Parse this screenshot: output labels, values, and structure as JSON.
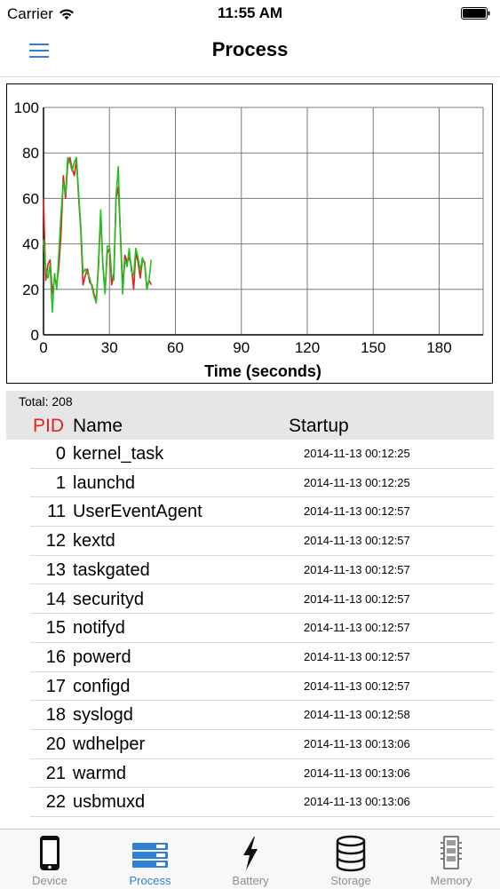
{
  "status_bar": {
    "carrier": "Carrier",
    "time": "11:55 AM"
  },
  "nav": {
    "title": "Process"
  },
  "chart_data": {
    "type": "line",
    "xlabel": "Time (seconds)",
    "ylabel": "",
    "xlim": [
      0,
      200
    ],
    "ylim": [
      0,
      100
    ],
    "x_ticks": [
      0,
      30,
      60,
      90,
      120,
      150,
      180
    ],
    "y_ticks": [
      0,
      20,
      40,
      60,
      80,
      100
    ],
    "grid": true,
    "series": [
      {
        "color": "#e02020",
        "x": [
          0,
          1,
          2,
          3,
          4,
          5,
          6,
          7,
          8,
          9,
          10,
          11,
          12,
          13,
          14,
          15,
          16,
          17,
          18,
          19,
          20,
          21,
          22,
          23,
          24,
          25,
          26,
          27,
          28,
          29,
          30,
          31,
          32,
          33,
          34,
          35,
          36,
          37,
          38,
          39,
          40,
          41,
          42,
          43,
          44,
          45,
          46,
          47,
          48,
          49
        ],
        "y": [
          60,
          24,
          31,
          33,
          18,
          25,
          22,
          30,
          45,
          70,
          60,
          75,
          78,
          73,
          70,
          77,
          60,
          45,
          22,
          26,
          29,
          23,
          22,
          18,
          15,
          30,
          53,
          31,
          19,
          36,
          38,
          22,
          27,
          60,
          65,
          45,
          20,
          35,
          32,
          34,
          30,
          20,
          36,
          32,
          25,
          33,
          32,
          21,
          24,
          22
        ]
      },
      {
        "color": "#20c020",
        "x": [
          0,
          1,
          2,
          3,
          4,
          5,
          6,
          7,
          8,
          9,
          10,
          11,
          12,
          13,
          14,
          15,
          16,
          17,
          18,
          19,
          20,
          21,
          22,
          23,
          24,
          25,
          26,
          27,
          28,
          29,
          30,
          31,
          32,
          33,
          34,
          35,
          36,
          37,
          38,
          39,
          40,
          41,
          42,
          43,
          44,
          45,
          46,
          47,
          48,
          49
        ],
        "y": [
          42,
          29,
          25,
          31,
          10,
          27,
          20,
          36,
          54,
          67,
          62,
          78,
          76,
          72,
          76,
          78,
          62,
          47,
          27,
          29,
          27,
          25,
          21,
          17,
          14,
          32,
          55,
          30,
          18,
          39,
          39,
          26,
          24,
          61,
          74,
          43,
          18,
          33,
          30,
          38,
          28,
          26,
          38,
          34,
          28,
          34,
          31,
          20,
          24,
          33
        ]
      }
    ]
  },
  "table": {
    "total": "Total: 208",
    "headers": {
      "pid": "PID",
      "name": "Name",
      "startup": "Startup"
    },
    "rows": [
      {
        "pid": "0",
        "name": "kernel_task",
        "startup": "2014-11-13 00:12:25"
      },
      {
        "pid": "1",
        "name": "launchd",
        "startup": "2014-11-13 00:12:25"
      },
      {
        "pid": "11",
        "name": "UserEventAgent",
        "startup": "2014-11-13 00:12:57"
      },
      {
        "pid": "12",
        "name": "kextd",
        "startup": "2014-11-13 00:12:57"
      },
      {
        "pid": "13",
        "name": "taskgated",
        "startup": "2014-11-13 00:12:57"
      },
      {
        "pid": "14",
        "name": "securityd",
        "startup": "2014-11-13 00:12:57"
      },
      {
        "pid": "15",
        "name": "notifyd",
        "startup": "2014-11-13 00:12:57"
      },
      {
        "pid": "16",
        "name": "powerd",
        "startup": "2014-11-13 00:12:57"
      },
      {
        "pid": "17",
        "name": "configd",
        "startup": "2014-11-13 00:12:57"
      },
      {
        "pid": "18",
        "name": "syslogd",
        "startup": "2014-11-13 00:12:58"
      },
      {
        "pid": "20",
        "name": "wdhelper",
        "startup": "2014-11-13 00:13:06"
      },
      {
        "pid": "21",
        "name": "warmd",
        "startup": "2014-11-13 00:13:06"
      },
      {
        "pid": "22",
        "name": "usbmuxd",
        "startup": "2014-11-13 00:13:06"
      }
    ]
  },
  "tabs": [
    {
      "label": "Device",
      "icon": "phone-icon",
      "active": false
    },
    {
      "label": "Process",
      "icon": "list-icon",
      "active": true
    },
    {
      "label": "Battery",
      "icon": "bolt-icon",
      "active": false
    },
    {
      "label": "Storage",
      "icon": "database-icon",
      "active": false
    },
    {
      "label": "Memory",
      "icon": "memory-chip-icon",
      "active": false
    }
  ],
  "colors": {
    "accent": "#2f7fd8",
    "pid_header": "#e32222",
    "tab_inactive": "#8e8e8e"
  }
}
